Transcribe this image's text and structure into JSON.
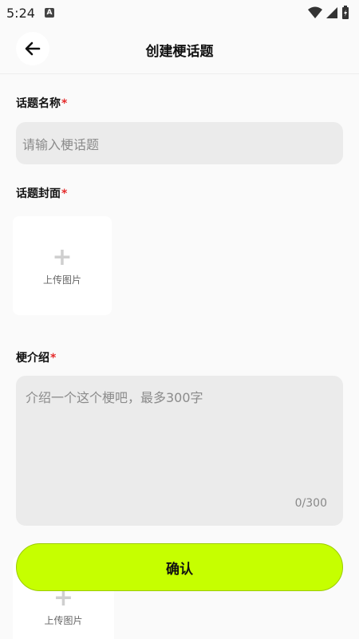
{
  "status_bar": {
    "time": "5:24",
    "notification_badge": "A",
    "icons": [
      "wifi-icon",
      "signal-icon",
      "battery-charging-icon"
    ]
  },
  "header": {
    "title": "创建梗话题",
    "back_icon": "arrow-left-icon"
  },
  "form": {
    "topic_name": {
      "label": "话题名称",
      "required_mark": "*",
      "placeholder": "请输入梗话题"
    },
    "topic_cover": {
      "label": "话题封面",
      "required_mark": "*",
      "upload_plus": "+",
      "upload_label": "上传图片"
    },
    "intro": {
      "label": "梗介绍",
      "required_mark": "*",
      "placeholder": "介绍一个这个梗吧，最多300字",
      "counter": "0/300"
    },
    "extra_upload": {
      "upload_plus": "+",
      "upload_label": "上传图片"
    }
  },
  "actions": {
    "confirm_label": "确认"
  },
  "colors": {
    "accent": "#c6ff00",
    "required": "#e52a2a",
    "input_bg": "#ebebeb"
  }
}
